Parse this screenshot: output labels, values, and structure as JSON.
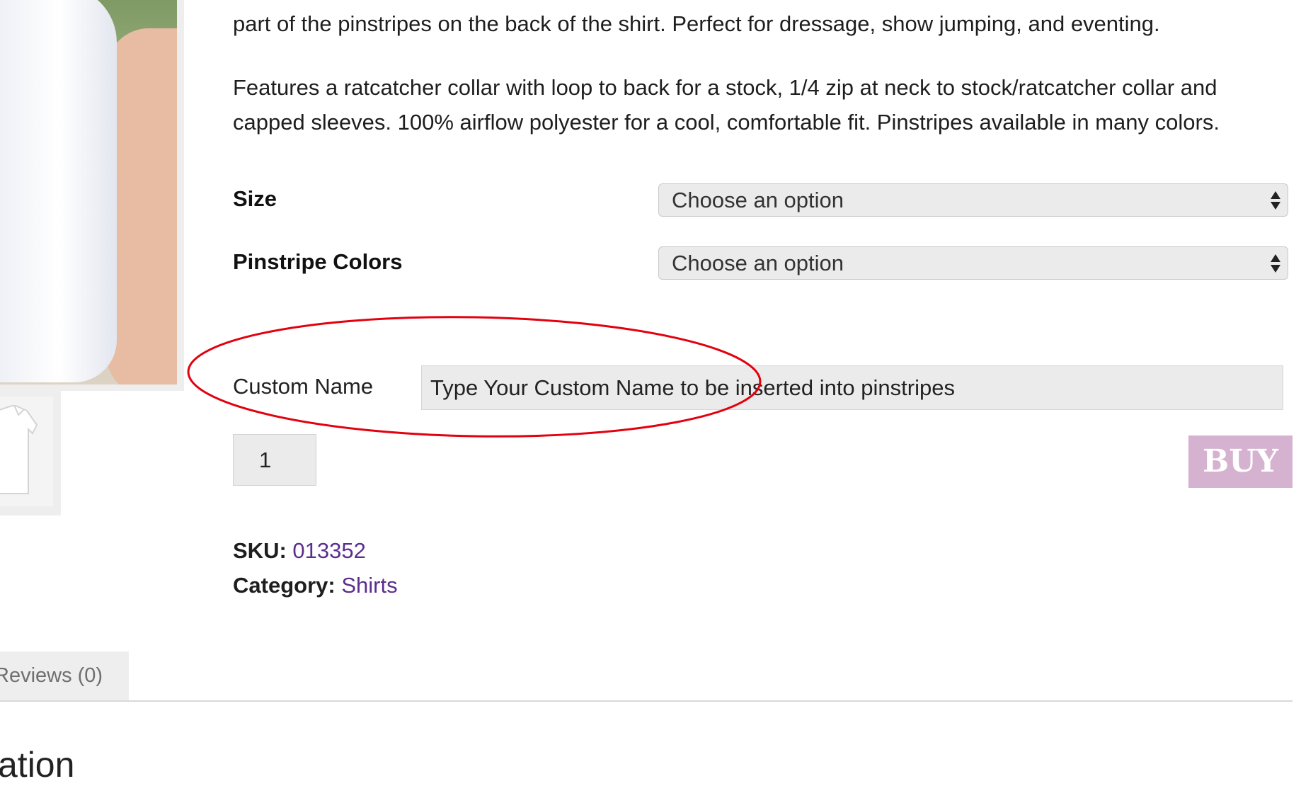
{
  "description": {
    "line_top": "part of the pinstripes on the back of the shirt. Perfect for dressage, show jumping, and eventing.",
    "features": "Features a ratcatcher collar with loop to back for a stock, 1/4 zip at neck to stock/ratcatcher collar and capped sleeves. 100% airflow polyester for a cool, comfortable fit. Pinstripes available in many colors."
  },
  "variations": [
    {
      "label": "Size",
      "selected": "Choose an option"
    },
    {
      "label": "Pinstripe Colors",
      "selected": "Choose an option"
    }
  ],
  "custom_name": {
    "label": "Custom Name",
    "placeholder": "Type Your Custom Name to be inserted into pinstripes"
  },
  "quantity": "1",
  "buy_label": "BUY",
  "meta": {
    "sku_label": "SKU:",
    "sku_value": "013352",
    "category_label": "Category:",
    "category_value": "Shirts"
  },
  "tabs": {
    "reviews": "Reviews (0)"
  },
  "section_heading": "ation",
  "colors": {
    "buy_button": "#d6b2d1",
    "link": "#5b2d8e",
    "annotation": "#e3000f"
  }
}
